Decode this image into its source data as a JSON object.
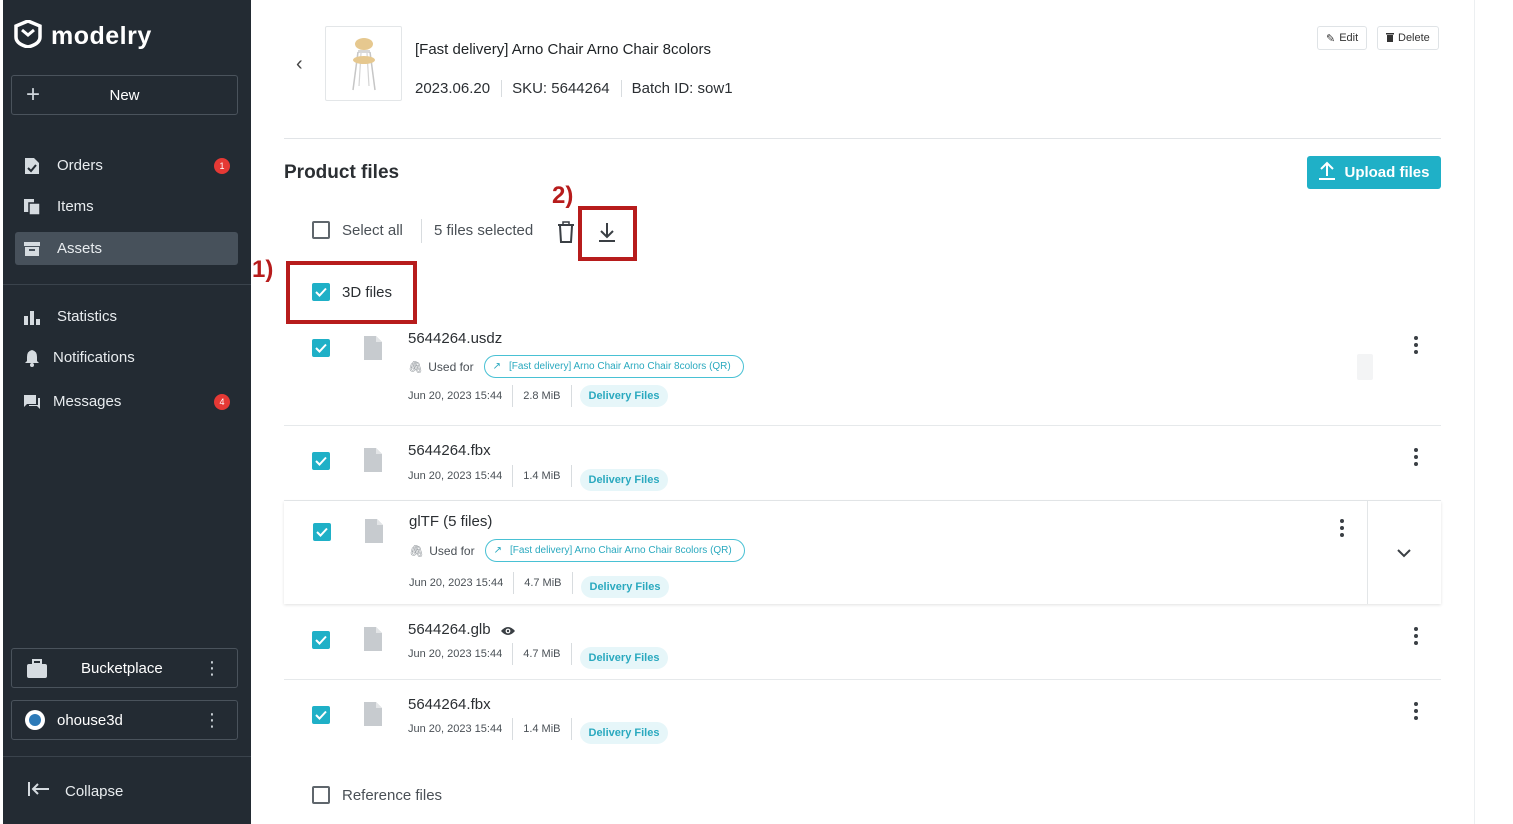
{
  "brand": {
    "name": "modelry"
  },
  "sidebar": {
    "new_label": "New",
    "nav": [
      {
        "label": "Orders",
        "badge": "1",
        "icon": "orders-icon"
      },
      {
        "label": "Items",
        "badge": "",
        "icon": "items-icon"
      },
      {
        "label": "Assets",
        "badge": "",
        "icon": "assets-icon",
        "active": true
      },
      {
        "label": "Statistics",
        "badge": "",
        "icon": "statistics-icon"
      },
      {
        "label": "Notifications",
        "badge": "",
        "icon": "bell-icon"
      },
      {
        "label": "Messages",
        "badge": "4",
        "icon": "messages-icon"
      }
    ],
    "orgs": [
      {
        "label": "Bucketplace",
        "icon": "briefcase-icon"
      },
      {
        "label": "ohouse3d",
        "icon": "org-avatar-icon"
      }
    ],
    "collapse_label": "Collapse"
  },
  "product": {
    "title": "[Fast delivery] Arno Chair Arno Chair 8colors",
    "date": "2023.06.20",
    "sku": "SKU: 5644264",
    "batch": "Batch ID: sow1",
    "edit_label": "Edit",
    "delete_label": "Delete"
  },
  "files_section": {
    "title": "Product files",
    "upload_label": "Upload files",
    "select_all_label": "Select all",
    "selected_count": "5 files selected",
    "group_3d_label": "3D files",
    "reference_label": "Reference files",
    "used_for_label": "Used for",
    "used_for_chip": "[Fast delivery] Arno Chair Arno Chair 8colors (QR)",
    "files": [
      {
        "name": "5644264.usdz",
        "date": "Jun 20, 2023 15:44",
        "size": "2.8 MiB",
        "tag": "Delivery Files",
        "checked": true,
        "used_for": true
      },
      {
        "name": "5644264.fbx",
        "date": "Jun 20, 2023 15:44",
        "size": "1.4 MiB",
        "tag": "Delivery Files",
        "checked": true,
        "used_for": false
      },
      {
        "name": "glTF (5 files)",
        "date": "Jun 20, 2023 15:44",
        "size": "4.7 MiB",
        "tag": "Delivery Files",
        "checked": true,
        "used_for": true
      },
      {
        "name": "5644264.glb",
        "date": "Jun 20, 2023 15:44",
        "size": "4.7 MiB",
        "tag": "Delivery Files",
        "checked": true,
        "used_for": false
      },
      {
        "name": "5644264.fbx",
        "date": "Jun 20, 2023 15:44",
        "size": "1.4 MiB",
        "tag": "Delivery Files",
        "checked": true,
        "used_for": false
      }
    ]
  },
  "annotations": {
    "one": "1)",
    "two": "2)"
  },
  "colors": {
    "sidebar_bg": "#232b33",
    "accent": "#1fb0c7",
    "annotation": "#b71c1c",
    "badge": "#e53935"
  }
}
